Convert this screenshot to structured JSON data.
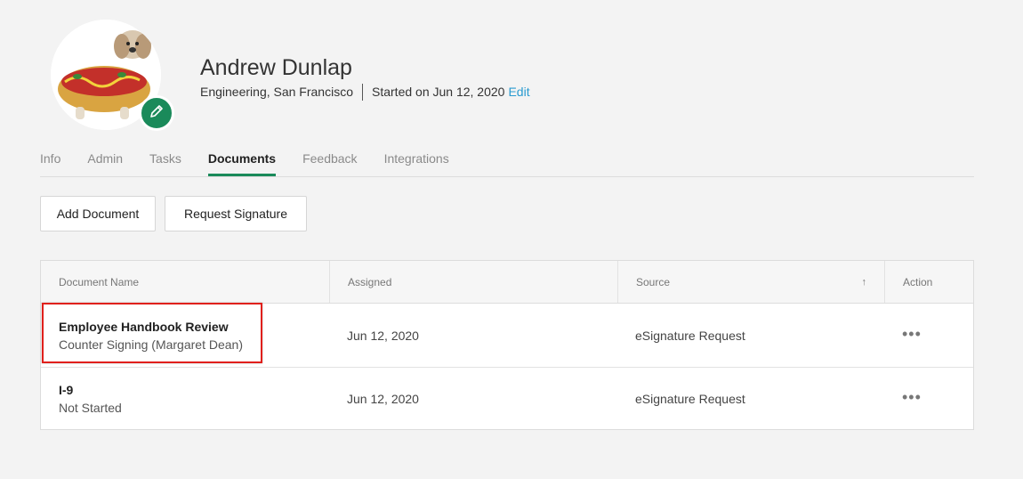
{
  "profile": {
    "name": "Andrew Dunlap",
    "department_location": "Engineering, San Francisco",
    "started": "Started on Jun 12, 2020",
    "edit_label": "Edit"
  },
  "tabs": [
    {
      "label": "Info"
    },
    {
      "label": "Admin"
    },
    {
      "label": "Tasks"
    },
    {
      "label": "Documents",
      "active": true
    },
    {
      "label": "Feedback"
    },
    {
      "label": "Integrations"
    }
  ],
  "actions": {
    "add_document": "Add Document",
    "request_signature": "Request Signature"
  },
  "table": {
    "headers": {
      "document_name": "Document Name",
      "assigned": "Assigned",
      "source": "Source",
      "action": "Action",
      "sort_icon": "↑"
    },
    "rows": [
      {
        "title": "Employee Handbook Review",
        "status": "Counter Signing (Margaret Dean)",
        "assigned": "Jun 12, 2020",
        "source": "eSignature Request",
        "action": "•••"
      },
      {
        "title": "I-9",
        "status": "Not Started",
        "assigned": "Jun 12, 2020",
        "source": "eSignature Request",
        "action": "•••"
      }
    ]
  },
  "colors": {
    "accent": "#1a8a5a",
    "link": "#2a9bd0",
    "highlight": "#e0201c"
  },
  "icons": {
    "avatar_edit": "pencil-icon",
    "sort": "sort-up-icon",
    "row_action": "more-horizontal-icon"
  }
}
